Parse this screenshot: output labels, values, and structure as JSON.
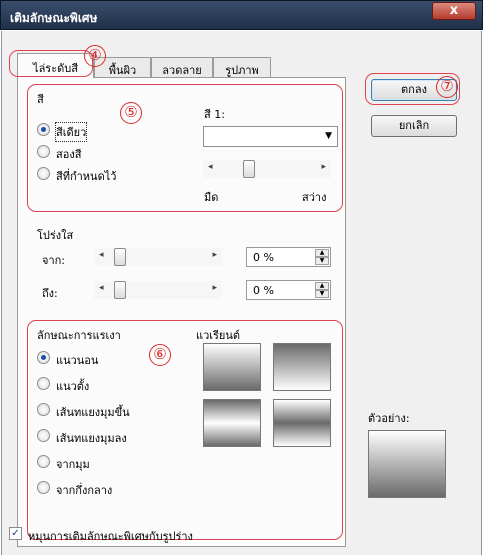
{
  "window": {
    "title": "เติมลักษณะพิเศษ",
    "close_glyph": "x"
  },
  "tabs": [
    {
      "label": "ไล่ระดับสี",
      "active": true
    },
    {
      "label": "พื้นผิว",
      "active": false
    },
    {
      "label": "ลวดลาย",
      "active": false
    },
    {
      "label": "รูปภาพ",
      "active": false
    }
  ],
  "markers": {
    "tabs": "④",
    "colors": "⑤",
    "shading": "⑥",
    "ok": "⑦"
  },
  "colors": {
    "heading": "สี",
    "options": [
      {
        "label": "สีเดียว",
        "checked": true
      },
      {
        "label": "สองสี",
        "checked": false
      },
      {
        "label": "สีที่กำหนดไว้",
        "checked": false
      }
    ],
    "color1_label": "สี 1:",
    "combo_arrow": "▼",
    "slider_left_label": "มืด",
    "slider_right_label": "สว่าง",
    "slider_left_arrow": "◂",
    "slider_right_arrow": "▸"
  },
  "transparency": {
    "heading": "โปร่งใส",
    "from_label": "จาก:",
    "to_label": "ถึง:",
    "from_value": "0 %",
    "to_value": "0 %",
    "spin_up": "▲",
    "spin_down": "▼"
  },
  "shading": {
    "heading": "ลักษณะการแรเงา",
    "variants_label": "แวเรียนต์",
    "options": [
      {
        "label": "แนวนอน",
        "checked": true
      },
      {
        "label": "แนวตั้ง",
        "checked": false
      },
      {
        "label": "เส้นทแยงมุมขึ้น",
        "checked": false
      },
      {
        "label": "เส้นทแยงมุมลง",
        "checked": false
      },
      {
        "label": "จากมุม",
        "checked": false
      },
      {
        "label": "จากกึ่งกลาง",
        "checked": false
      }
    ]
  },
  "sample": {
    "label": "ตัวอย่าง:"
  },
  "buttons": {
    "ok": "ตกลง",
    "cancel": "ยกเลิก"
  },
  "rotate_checkbox": {
    "label": "หมุนการเติมลักษณะพิเศษกับรูปร่าง",
    "checked": true,
    "check_glyph": "✓"
  },
  "colors_palette": {
    "titlebar": "#2c3e5c",
    "accent_red": "#e0434f",
    "radio_dot": "#1b4fa8"
  }
}
